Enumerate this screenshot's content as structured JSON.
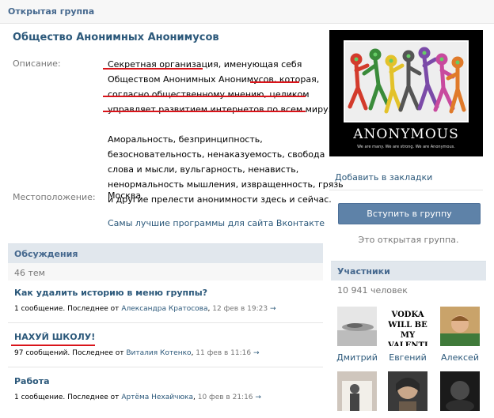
{
  "header": {
    "title": "Открытая группа"
  },
  "group": {
    "name": "Общество Анонимных Анонимусов",
    "description_label": "Описание:",
    "description_lines": [
      "Секретная организация, именующая себя",
      "Обществом Анонимных Анонимусов, которая,",
      "согласно общественному мнению, целиком",
      "управляет развитием интернетов по всем миру.",
      "Аморальность, безпринципность,",
      "безосновательность, ненаказуемость, свобода",
      "слова и мысли, вульгарность, ненависть,",
      "ненормальность мышления, извращенность, грязь",
      "и другие прелести анонимности здесь и сейчас."
    ],
    "location_label": "Местоположение:",
    "location": "Москва",
    "promo_link": "Самы лучшие программы для сайта Вконтакте"
  },
  "discussions": {
    "title": "Обсуждения",
    "count": "46 тем",
    "topics": [
      {
        "title": "Как удалить историю в меню группы?",
        "messages": "1 сообщение.",
        "last_prefix": "Последнее от",
        "author": "Александра Кратосова",
        "date": "12 фев в 19:23",
        "arrow": "→"
      },
      {
        "title": "НАХУЙ ШКОЛУ!",
        "messages": "97 сообщений.",
        "last_prefix": "Последнее от",
        "author": "Виталия Котенко",
        "date": "11 фев в 11:16",
        "arrow": "→"
      },
      {
        "title": "Работа",
        "messages": "1 сообщение.",
        "last_prefix": "Последнее от",
        "author": "Артёма Нехайчюка",
        "date": "10 фев в 21:16",
        "arrow": "→"
      }
    ]
  },
  "poster": {
    "title": "ANONYMOUS",
    "subtitle": "We are many. We are strong. We are Anonymous."
  },
  "sidebar": {
    "bookmark_link": "Добавить в закладки",
    "join_button": "Вступить в группу",
    "open_note": "Это открытая группа.",
    "members_title": "Участники",
    "members_count": "10 941 человек",
    "members": [
      {
        "name": "Дмитрий"
      },
      {
        "name": "Евгений",
        "avatar_text": "VODKA WILL BE MY VALENTINE"
      },
      {
        "name": "Алексей"
      }
    ]
  },
  "colors": {
    "link": "#2b587a",
    "section_bg": "#e1e7ed",
    "button": "#5e82a8",
    "annotation_red": "#d9141a"
  }
}
